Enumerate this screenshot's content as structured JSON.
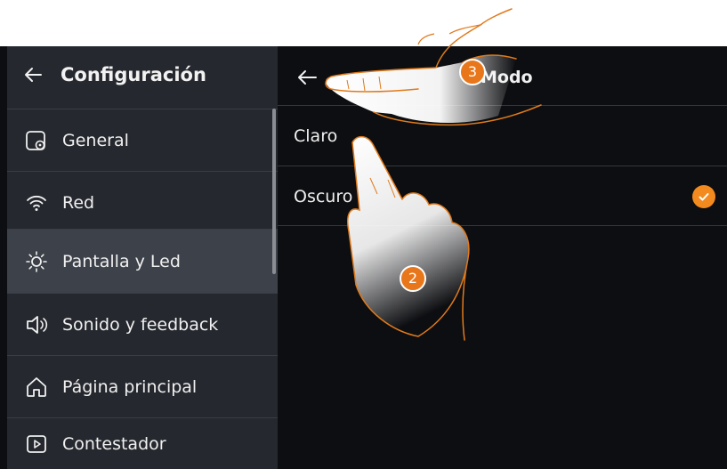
{
  "sidebar": {
    "title": "Configuración",
    "items": [
      {
        "label": "General",
        "icon": "display-gear-icon"
      },
      {
        "label": "Red",
        "icon": "wifi-icon"
      },
      {
        "label": "Pantalla y Led",
        "icon": "brightness-icon"
      },
      {
        "label": "Sonido y feedback",
        "icon": "speaker-icon"
      },
      {
        "label": "Página principal",
        "icon": "home-icon"
      },
      {
        "label": "Contestador",
        "icon": "play-box-icon"
      }
    ],
    "active_index": 2
  },
  "panel": {
    "title": "Modo",
    "options": [
      {
        "label": "Claro",
        "selected": false
      },
      {
        "label": "Oscuro",
        "selected": true
      }
    ]
  },
  "steps": {
    "step_a": "3",
    "step_b": "2"
  },
  "colors": {
    "accent": "#f28a1f",
    "sidebar_bg": "#25282e",
    "sidebar_active": "#3d4149",
    "panel_bg": "#0d0e11"
  }
}
